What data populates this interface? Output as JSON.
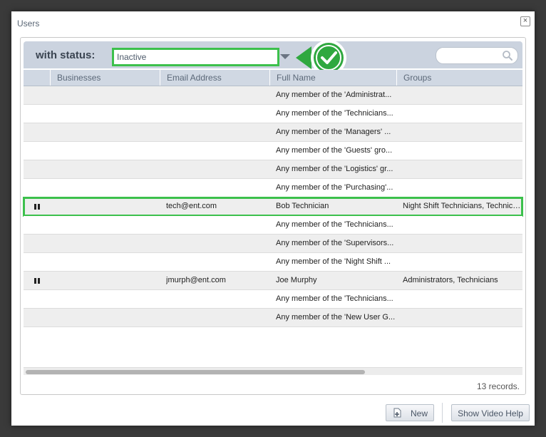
{
  "dialog": {
    "title": "Users",
    "close_label": "×"
  },
  "toolbar": {
    "status_label": "with status:",
    "status_value": "Inactive",
    "search_placeholder": ""
  },
  "table": {
    "columns": [
      "",
      "Businesses",
      "Email Address",
      "Full Name",
      "Groups"
    ],
    "rows": [
      {
        "status_icon": "",
        "business": "",
        "email": "",
        "full_name": "Any member of the 'Administrat...",
        "groups": ""
      },
      {
        "status_icon": "",
        "business": "",
        "email": "",
        "full_name": "Any member of the 'Technicians...",
        "groups": ""
      },
      {
        "status_icon": "",
        "business": "",
        "email": "",
        "full_name": "Any member of the 'Managers' ...",
        "groups": ""
      },
      {
        "status_icon": "",
        "business": "",
        "email": "",
        "full_name": "Any member of the 'Guests' gro...",
        "groups": ""
      },
      {
        "status_icon": "",
        "business": "",
        "email": "",
        "full_name": "Any member of the 'Logistics' gr...",
        "groups": ""
      },
      {
        "status_icon": "",
        "business": "",
        "email": "",
        "full_name": "Any member of the 'Purchasing'...",
        "groups": ""
      },
      {
        "status_icon": "pause-icon",
        "business": "",
        "email": "tech@ent.com",
        "full_name": "Bob Technician",
        "groups": "Night Shift Technicians, Technicia...",
        "highlighted": true
      },
      {
        "status_icon": "",
        "business": "",
        "email": "",
        "full_name": "Any member of the 'Technicians...",
        "groups": ""
      },
      {
        "status_icon": "",
        "business": "",
        "email": "",
        "full_name": "Any member of the 'Supervisors...",
        "groups": ""
      },
      {
        "status_icon": "",
        "business": "",
        "email": "",
        "full_name": "Any member of the 'Night Shift ...",
        "groups": ""
      },
      {
        "status_icon": "pause-icon",
        "business": "",
        "email": "jmurph@ent.com",
        "full_name": "Joe Murphy",
        "groups": "Administrators, Technicians"
      },
      {
        "status_icon": "",
        "business": "",
        "email": "",
        "full_name": "Any member of the 'Technicians...",
        "groups": ""
      },
      {
        "status_icon": "",
        "business": "",
        "email": "",
        "full_name": "Any member of the 'New User G...",
        "groups": ""
      }
    ]
  },
  "footer": {
    "records_text": "13 records.",
    "new_button": "New",
    "video_help_button": "Show Video Help"
  },
  "colors": {
    "highlight": "#3cc04c",
    "toolbar_bg": "#cbd3df",
    "header_bg": "#d0d8e3"
  }
}
